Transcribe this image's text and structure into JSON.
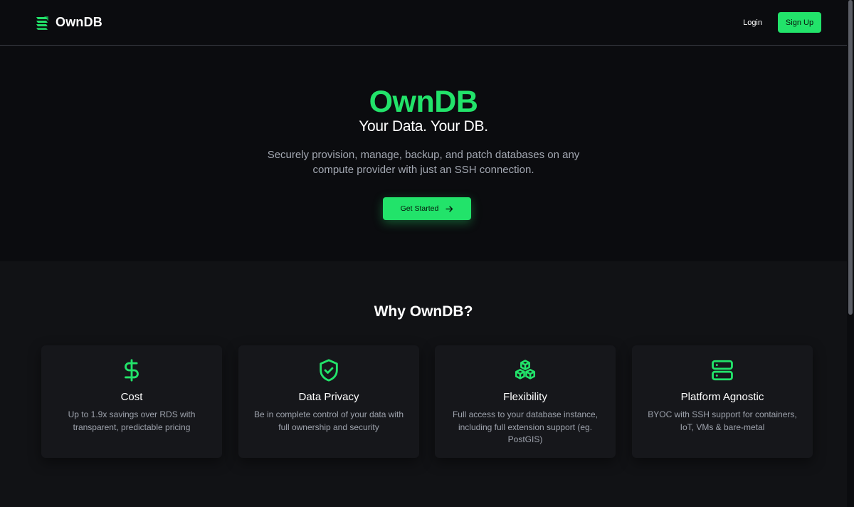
{
  "header": {
    "brand_name": "OwnDB",
    "brand_icon": "database-stack-icon",
    "login_label": "Login",
    "signup_label": "Sign Up"
  },
  "hero": {
    "title": "OwnDB",
    "tagline": "Your Data. Your DB.",
    "description": "Securely provision, manage, backup, and patch databases on any compute provider with just an SSH connection.",
    "cta_label": "Get Started",
    "cta_icon": "arrow-right-icon"
  },
  "features": {
    "heading": "Why OwnDB?",
    "cards": [
      {
        "title": "Cost",
        "description": "Up to 1.9x savings over RDS with transparent, predictable pricing",
        "icon": "dollar-icon"
      },
      {
        "title": "Data Privacy",
        "description": "Be in complete control of your data with full ownership and security",
        "icon": "shield-check-icon"
      },
      {
        "title": "Flexibility",
        "description": "Full access to your database instance, including full extension support (eg. PostGIS)",
        "icon": "cubes-icon"
      },
      {
        "title": "Platform Agnostic",
        "description": "BYOC with SSH support for containers, IoT, VMs & bare-metal",
        "icon": "server-icon"
      }
    ]
  },
  "colors": {
    "accent": "#22e36a",
    "background": "#0b0c0f",
    "section_background": "#111215",
    "card_background": "#16171b",
    "muted_text": "#a3a8b2"
  }
}
